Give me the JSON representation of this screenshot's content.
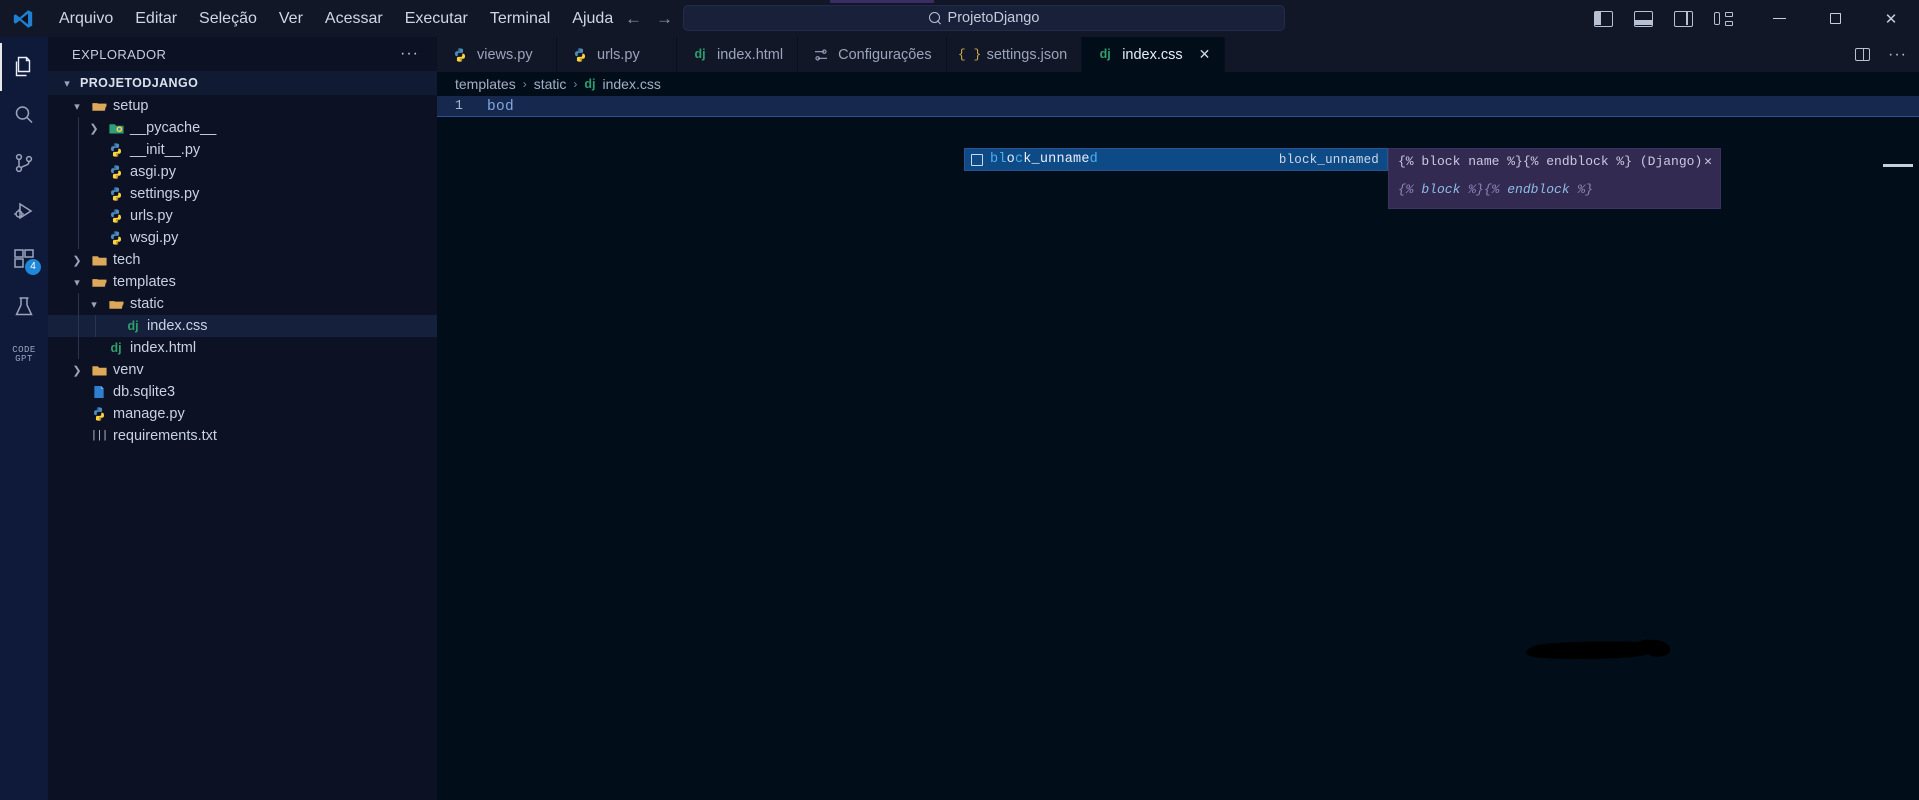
{
  "app": {
    "logo_icon": "vscode-logo-icon",
    "menu": [
      "Arquivo",
      "Editar",
      "Seleção",
      "Ver",
      "Acessar",
      "Executar",
      "Terminal",
      "Ajuda"
    ],
    "nav": {
      "back_icon": "arrow-left-icon",
      "forward_icon": "arrow-right-icon"
    },
    "search": {
      "icon": "search-icon",
      "value": "ProjetoDjango"
    },
    "layout_buttons": [
      {
        "name": "toggle-primary-sidebar",
        "icon": "layout-sidebar-left-icon"
      },
      {
        "name": "toggle-panel",
        "icon": "layout-panel-bottom-icon"
      },
      {
        "name": "toggle-secondary-sidebar",
        "icon": "layout-sidebar-right-icon"
      },
      {
        "name": "customize-layout",
        "icon": "layout-grid-icon"
      }
    ],
    "window_controls": {
      "minimize": "─",
      "maximize": "❐",
      "close": "✕"
    },
    "accent_color": "#3b2d63"
  },
  "activitybar": {
    "items": [
      {
        "name": "explorer",
        "icon": "files-icon",
        "active": true,
        "badge": ""
      },
      {
        "name": "search",
        "icon": "search-icon",
        "active": false,
        "badge": ""
      },
      {
        "name": "source-control",
        "icon": "source-control-icon",
        "active": false,
        "badge": ""
      },
      {
        "name": "run-and-debug",
        "icon": "run-debug-icon",
        "active": false,
        "badge": ""
      },
      {
        "name": "extensions",
        "icon": "extensions-icon",
        "active": false,
        "badge": "4"
      },
      {
        "name": "testing",
        "icon": "beaker-icon",
        "active": false,
        "badge": ""
      },
      {
        "name": "code-gpt",
        "icon": "codegpt-icon",
        "active": false,
        "badge": "",
        "label": "CODE\nGPT"
      }
    ],
    "badge_color": "#1f87d8"
  },
  "sidebar": {
    "title": "EXPLORADOR",
    "more_actions": "···",
    "root": {
      "label": "PROJETODJANGO",
      "expanded": true
    },
    "tree": [
      {
        "label": "setup",
        "type": "folder",
        "state": "expanded",
        "depth": 1,
        "icon": "folder-open-icon"
      },
      {
        "label": "__pycache__",
        "type": "folder",
        "state": "collapsed",
        "depth": 2,
        "icon": "folder-pycache-icon"
      },
      {
        "label": "__init__.py",
        "type": "file",
        "state": "none",
        "depth": 2,
        "icon": "python-icon"
      },
      {
        "label": "asgi.py",
        "type": "file",
        "state": "none",
        "depth": 2,
        "icon": "python-icon"
      },
      {
        "label": "settings.py",
        "type": "file",
        "state": "none",
        "depth": 2,
        "icon": "python-icon"
      },
      {
        "label": "urls.py",
        "type": "file",
        "state": "none",
        "depth": 2,
        "icon": "python-icon"
      },
      {
        "label": "wsgi.py",
        "type": "file",
        "state": "none",
        "depth": 2,
        "icon": "python-icon"
      },
      {
        "label": "tech",
        "type": "folder",
        "state": "collapsed",
        "depth": 1,
        "icon": "folder-icon"
      },
      {
        "label": "templates",
        "type": "folder",
        "state": "expanded",
        "depth": 1,
        "icon": "folder-open-icon"
      },
      {
        "label": "static",
        "type": "folder",
        "state": "expanded",
        "depth": 2,
        "icon": "folder-open-icon"
      },
      {
        "label": "index.css",
        "type": "file",
        "state": "none",
        "depth": 3,
        "icon": "django-icon",
        "selected": true
      },
      {
        "label": "index.html",
        "type": "file",
        "state": "none",
        "depth": 2,
        "icon": "django-icon"
      },
      {
        "label": "venv",
        "type": "folder",
        "state": "collapsed",
        "depth": 1,
        "icon": "folder-icon"
      },
      {
        "label": "db.sqlite3",
        "type": "file",
        "state": "none",
        "depth": 1,
        "icon": "database-icon"
      },
      {
        "label": "manage.py",
        "type": "file",
        "state": "none",
        "depth": 1,
        "icon": "python-icon"
      },
      {
        "label": "requirements.txt",
        "type": "file",
        "state": "none",
        "depth": 1,
        "icon": "text-file-icon"
      }
    ]
  },
  "editor": {
    "tabs": [
      {
        "label": "views.py",
        "icon": "python-icon",
        "active": false,
        "closable": false
      },
      {
        "label": "urls.py",
        "icon": "python-icon",
        "active": false,
        "closable": false
      },
      {
        "label": "index.html",
        "icon": "django-icon",
        "active": false,
        "closable": false
      },
      {
        "label": "Configurações",
        "icon": "settings-icon",
        "active": false,
        "closable": false
      },
      {
        "label": "settings.json",
        "icon": "json-icon",
        "active": false,
        "closable": false
      },
      {
        "label": "index.css",
        "icon": "django-icon",
        "active": true,
        "closable": true,
        "close_glyph": "✕"
      }
    ],
    "tabbar_actions": [
      {
        "name": "split-editor",
        "icon": "split-editor-icon"
      },
      {
        "name": "more-actions",
        "icon": "ellipsis-icon"
      }
    ],
    "breadcrumb": [
      {
        "label": "templates",
        "icon": ""
      },
      {
        "label": "static",
        "icon": ""
      },
      {
        "label": "index.css",
        "icon": "django-icon"
      }
    ],
    "breadcrumb_separator": "›",
    "lines": [
      {
        "number": "1",
        "text": "bod"
      }
    ]
  },
  "suggest": {
    "item": {
      "icon": "snippet-icon",
      "text": "block_unnamed",
      "highlight_indices": [
        0,
        1,
        12
      ],
      "detail": "block_unnamed"
    },
    "details": {
      "title": "{% block name %}{% endblock %} (Django)",
      "close_glyph": "✕",
      "body_prefix": "{% ",
      "body_kw1": "block",
      "body_mid": "  %}{% ",
      "body_kw2": "endblock",
      "body_suffix": " %}"
    }
  },
  "annotation": {
    "ink_blob": {
      "label": "black-ink-redaction-mark"
    }
  }
}
